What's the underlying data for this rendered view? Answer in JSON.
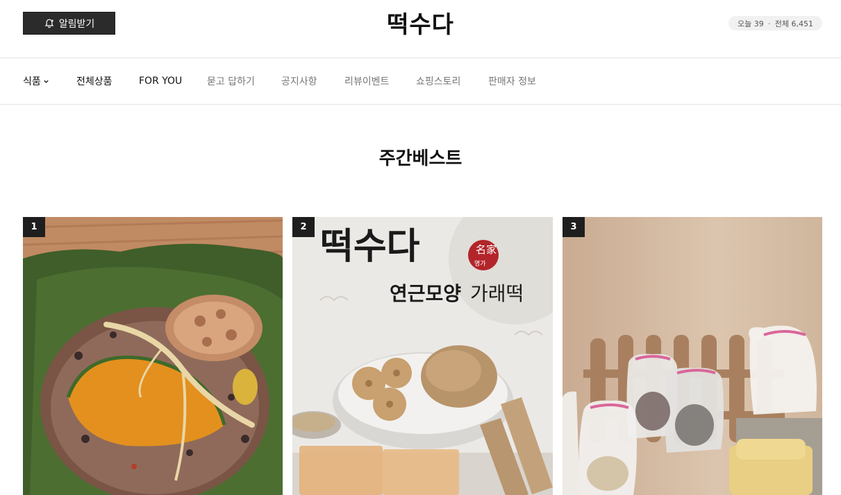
{
  "header": {
    "notify_label": "알림받기",
    "logo": "떡수다",
    "visitors": {
      "today_label": "오늘 39",
      "separator": "-",
      "total_label": "전체 6,451"
    }
  },
  "nav": {
    "items": [
      {
        "label": "식품"
      },
      {
        "label": "전체상품"
      },
      {
        "label": "FOR YOU"
      },
      {
        "label": "묻고 답하기"
      },
      {
        "label": "공지사항"
      },
      {
        "label": "리뷰이벤트"
      },
      {
        "label": "쇼핑스토리"
      },
      {
        "label": "판매자 정보"
      }
    ]
  },
  "section": {
    "title": "주간베스트"
  },
  "products": [
    {
      "rank": "1",
      "image_desc": "lotus-leaf-rice"
    },
    {
      "rank": "2",
      "brand": "떡수다",
      "seal": "名家",
      "seal_sub": "명가",
      "caption_bold": "연근모양",
      "caption_light": "가래떡"
    },
    {
      "rank": "3",
      "image_desc": "rice-cake-gift-bags"
    }
  ],
  "colors": {
    "accent_dark": "#2b2b2b",
    "seal_red": "#b3252a"
  }
}
